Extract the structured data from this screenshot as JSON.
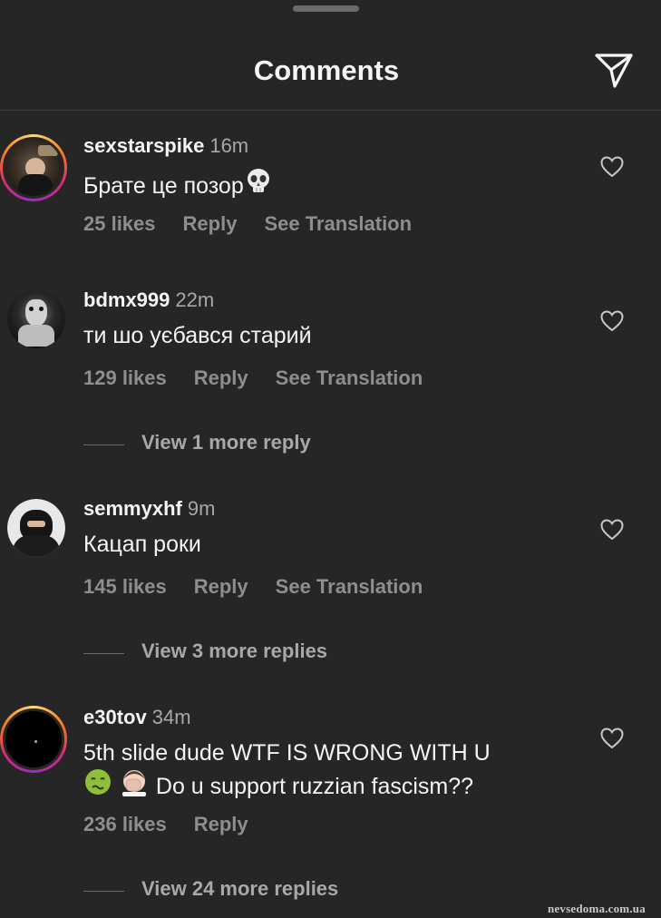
{
  "header": {
    "title": "Comments",
    "share_icon": "send-icon"
  },
  "comments": [
    {
      "username": "sexstarspike",
      "time": "16m",
      "text_lines": [
        "Брате це позор"
      ],
      "likes": "25 likes",
      "reply": "Reply",
      "translate": "See Translation",
      "view_more": ""
    },
    {
      "username": "bdmx999",
      "time": "22m",
      "text_lines": [
        "ти шо уєбався старий"
      ],
      "likes": "129 likes",
      "reply": "Reply",
      "translate": "See Translation",
      "view_more": "View 1 more reply"
    },
    {
      "username": "semmyxhf",
      "time": "9m",
      "text_lines": [
        "Кацап роки"
      ],
      "likes": "145 likes",
      "reply": "Reply",
      "translate": "See Translation",
      "view_more": "View 3 more replies"
    },
    {
      "username": "e30tov",
      "time": "34m",
      "text_lines": [
        "5th slide dude WTF IS WRONG WITH U",
        "Do u support ruzzian fascism??"
      ],
      "likes": "236 likes",
      "reply": "Reply",
      "translate": "",
      "view_more": "View 24 more replies"
    }
  ],
  "watermark": "nevsedoma.com.ua",
  "colors": {
    "background": "#262626",
    "text": "#f5f5f5",
    "secondary": "#8e8e8e"
  }
}
